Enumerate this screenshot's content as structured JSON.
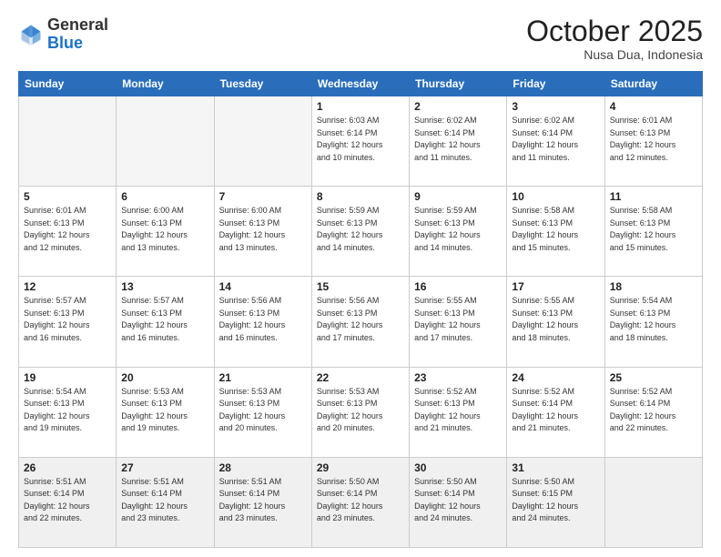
{
  "header": {
    "logo_general": "General",
    "logo_blue": "Blue",
    "month_title": "October 2025",
    "location": "Nusa Dua, Indonesia"
  },
  "days_of_week": [
    "Sunday",
    "Monday",
    "Tuesday",
    "Wednesday",
    "Thursday",
    "Friday",
    "Saturday"
  ],
  "weeks": [
    [
      {
        "day": "",
        "info": ""
      },
      {
        "day": "",
        "info": ""
      },
      {
        "day": "",
        "info": ""
      },
      {
        "day": "1",
        "info": "Sunrise: 6:03 AM\nSunset: 6:14 PM\nDaylight: 12 hours\nand 10 minutes."
      },
      {
        "day": "2",
        "info": "Sunrise: 6:02 AM\nSunset: 6:14 PM\nDaylight: 12 hours\nand 11 minutes."
      },
      {
        "day": "3",
        "info": "Sunrise: 6:02 AM\nSunset: 6:14 PM\nDaylight: 12 hours\nand 11 minutes."
      },
      {
        "day": "4",
        "info": "Sunrise: 6:01 AM\nSunset: 6:13 PM\nDaylight: 12 hours\nand 12 minutes."
      }
    ],
    [
      {
        "day": "5",
        "info": "Sunrise: 6:01 AM\nSunset: 6:13 PM\nDaylight: 12 hours\nand 12 minutes."
      },
      {
        "day": "6",
        "info": "Sunrise: 6:00 AM\nSunset: 6:13 PM\nDaylight: 12 hours\nand 13 minutes."
      },
      {
        "day": "7",
        "info": "Sunrise: 6:00 AM\nSunset: 6:13 PM\nDaylight: 12 hours\nand 13 minutes."
      },
      {
        "day": "8",
        "info": "Sunrise: 5:59 AM\nSunset: 6:13 PM\nDaylight: 12 hours\nand 14 minutes."
      },
      {
        "day": "9",
        "info": "Sunrise: 5:59 AM\nSunset: 6:13 PM\nDaylight: 12 hours\nand 14 minutes."
      },
      {
        "day": "10",
        "info": "Sunrise: 5:58 AM\nSunset: 6:13 PM\nDaylight: 12 hours\nand 15 minutes."
      },
      {
        "day": "11",
        "info": "Sunrise: 5:58 AM\nSunset: 6:13 PM\nDaylight: 12 hours\nand 15 minutes."
      }
    ],
    [
      {
        "day": "12",
        "info": "Sunrise: 5:57 AM\nSunset: 6:13 PM\nDaylight: 12 hours\nand 16 minutes."
      },
      {
        "day": "13",
        "info": "Sunrise: 5:57 AM\nSunset: 6:13 PM\nDaylight: 12 hours\nand 16 minutes."
      },
      {
        "day": "14",
        "info": "Sunrise: 5:56 AM\nSunset: 6:13 PM\nDaylight: 12 hours\nand 16 minutes."
      },
      {
        "day": "15",
        "info": "Sunrise: 5:56 AM\nSunset: 6:13 PM\nDaylight: 12 hours\nand 17 minutes."
      },
      {
        "day": "16",
        "info": "Sunrise: 5:55 AM\nSunset: 6:13 PM\nDaylight: 12 hours\nand 17 minutes."
      },
      {
        "day": "17",
        "info": "Sunrise: 5:55 AM\nSunset: 6:13 PM\nDaylight: 12 hours\nand 18 minutes."
      },
      {
        "day": "18",
        "info": "Sunrise: 5:54 AM\nSunset: 6:13 PM\nDaylight: 12 hours\nand 18 minutes."
      }
    ],
    [
      {
        "day": "19",
        "info": "Sunrise: 5:54 AM\nSunset: 6:13 PM\nDaylight: 12 hours\nand 19 minutes."
      },
      {
        "day": "20",
        "info": "Sunrise: 5:53 AM\nSunset: 6:13 PM\nDaylight: 12 hours\nand 19 minutes."
      },
      {
        "day": "21",
        "info": "Sunrise: 5:53 AM\nSunset: 6:13 PM\nDaylight: 12 hours\nand 20 minutes."
      },
      {
        "day": "22",
        "info": "Sunrise: 5:53 AM\nSunset: 6:13 PM\nDaylight: 12 hours\nand 20 minutes."
      },
      {
        "day": "23",
        "info": "Sunrise: 5:52 AM\nSunset: 6:13 PM\nDaylight: 12 hours\nand 21 minutes."
      },
      {
        "day": "24",
        "info": "Sunrise: 5:52 AM\nSunset: 6:14 PM\nDaylight: 12 hours\nand 21 minutes."
      },
      {
        "day": "25",
        "info": "Sunrise: 5:52 AM\nSunset: 6:14 PM\nDaylight: 12 hours\nand 22 minutes."
      }
    ],
    [
      {
        "day": "26",
        "info": "Sunrise: 5:51 AM\nSunset: 6:14 PM\nDaylight: 12 hours\nand 22 minutes."
      },
      {
        "day": "27",
        "info": "Sunrise: 5:51 AM\nSunset: 6:14 PM\nDaylight: 12 hours\nand 23 minutes."
      },
      {
        "day": "28",
        "info": "Sunrise: 5:51 AM\nSunset: 6:14 PM\nDaylight: 12 hours\nand 23 minutes."
      },
      {
        "day": "29",
        "info": "Sunrise: 5:50 AM\nSunset: 6:14 PM\nDaylight: 12 hours\nand 23 minutes."
      },
      {
        "day": "30",
        "info": "Sunrise: 5:50 AM\nSunset: 6:14 PM\nDaylight: 12 hours\nand 24 minutes."
      },
      {
        "day": "31",
        "info": "Sunrise: 5:50 AM\nSunset: 6:15 PM\nDaylight: 12 hours\nand 24 minutes."
      },
      {
        "day": "",
        "info": ""
      }
    ]
  ]
}
